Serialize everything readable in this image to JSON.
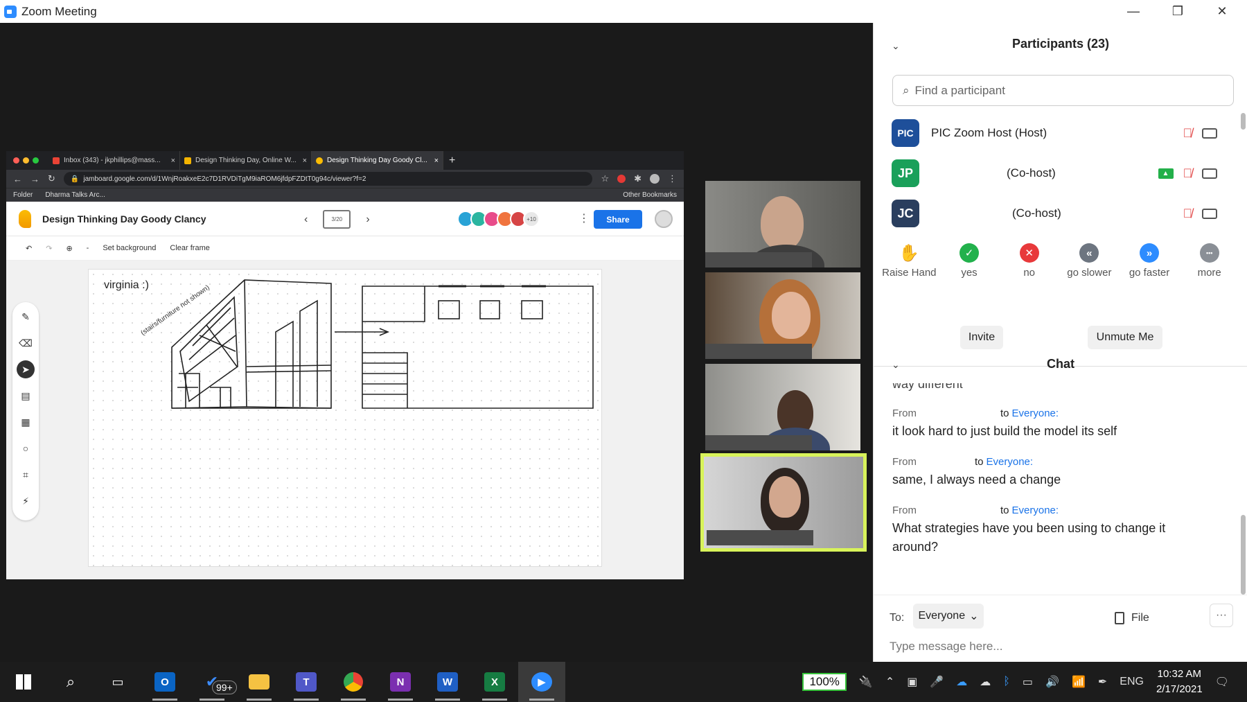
{
  "window": {
    "title": "Zoom Meeting",
    "min": "—",
    "restore": "❐",
    "close": "✕"
  },
  "browser": {
    "tabs": [
      {
        "label": "Inbox (343) - jkphillips@mass...",
        "close": "×"
      },
      {
        "label": "Design Thinking Day, Online W...",
        "close": "×"
      },
      {
        "label": "Design Thinking Day Goody Cl...",
        "close": "×"
      }
    ],
    "new_tab": "+",
    "url": "jamboard.google.com/d/1WnjRoakxeE2c7D1RVDiTgM9iaROM6jfdpFZDtT0g94c/viewer?f=2",
    "bookmarks": [
      "Folder",
      "Dharma Talks Arc..."
    ],
    "other_bookmarks": "Other Bookmarks"
  },
  "jamboard": {
    "title": "Design Thinking Day Goody Clancy",
    "frame": "3/20",
    "more_collaborators": "+10",
    "share": "Share",
    "toolbar": {
      "set_background": "Set background",
      "clear_frame": "Clear frame",
      "zoom_minus": "-"
    },
    "board_note": "virginia :)",
    "sketch_note": "(stairs/furniture not shown)"
  },
  "participants": {
    "header": "Participants (23)",
    "search_placeholder": "Find a participant",
    "list": [
      {
        "avatar": "PIC",
        "name": "PIC Zoom Host (Host)",
        "color": "#1e4f9a"
      },
      {
        "avatar": "JP",
        "name": "(Co-host)",
        "color": "#1aa05a"
      },
      {
        "avatar": "JC",
        "name": "(Co-host)",
        "color": "#2a3e5e"
      }
    ],
    "reactions": [
      {
        "label": "Raise Hand",
        "icon": "✋"
      },
      {
        "label": "yes",
        "icon": "✓"
      },
      {
        "label": "no",
        "icon": "✕"
      },
      {
        "label": "go slower",
        "icon": "«"
      },
      {
        "label": "go faster",
        "icon": "»"
      },
      {
        "label": "more",
        "icon": "•••"
      }
    ],
    "invite": "Invite",
    "unmute": "Unmute Me"
  },
  "chat": {
    "header": "Chat",
    "partial": "way different",
    "messages": [
      {
        "from": "From",
        "to": "to",
        "audience": "Everyone:",
        "text": "it look hard to just build the model its self"
      },
      {
        "from": "From",
        "to": "to",
        "audience": "Everyone:",
        "text": "same, I always need a change"
      },
      {
        "from": "From",
        "to": "to",
        "audience": "Everyone:",
        "text": "What strategies have you been using to change it around?"
      }
    ],
    "to_label": "To:",
    "recipient": "Everyone",
    "file": "File",
    "placeholder": "Type message here..."
  },
  "taskbar": {
    "badge": "99+",
    "battery": "100%",
    "lang": "ENG",
    "time": "10:32 AM",
    "date": "2/17/2021"
  }
}
